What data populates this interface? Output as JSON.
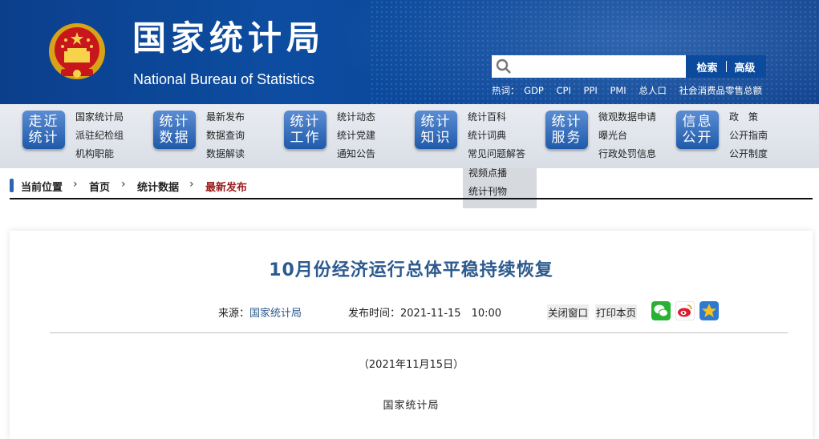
{
  "header": {
    "title": "国家统计局",
    "subtitle": "National Bureau of Statistics",
    "search": {
      "placeholder": "",
      "search_label": "检索",
      "advanced_label": "高级"
    },
    "hot_label": "热词：",
    "hot_words": [
      "GDP",
      "CPI",
      "PPI",
      "PMI",
      "总人口",
      "社会消费品零售总额"
    ]
  },
  "nav": [
    {
      "block": [
        "走近",
        "统计"
      ],
      "links": [
        "国家统计局",
        "派驻纪检组",
        "机构职能"
      ]
    },
    {
      "block": [
        "统计",
        "数据"
      ],
      "links": [
        "最新发布",
        "数据查询",
        "数据解读"
      ]
    },
    {
      "block": [
        "统计",
        "工作"
      ],
      "links": [
        "统计动态",
        "统计党建",
        "通知公告"
      ]
    },
    {
      "block": [
        "统计",
        "知识"
      ],
      "links": [
        "统计百科",
        "统计词典",
        "常见问题解答",
        "视频点播",
        "统计刊物"
      ]
    },
    {
      "block": [
        "统计",
        "服务"
      ],
      "links": [
        "微观数据申请",
        "曝光台",
        "行政处罚信息"
      ]
    },
    {
      "block": [
        "信息",
        "公开"
      ],
      "links": [
        "政　策",
        "公开指南",
        "公开制度"
      ]
    }
  ],
  "breadcrumb": {
    "label": "当前位置",
    "items": [
      "首页",
      "统计数据",
      "最新发布"
    ]
  },
  "article": {
    "title": "10月份经济运行总体平稳持续恢复",
    "source_label": "来源：",
    "source": "国家统计局",
    "time_label": "发布时间：",
    "time": "2021-11-15　10:00",
    "close_label": "关闭窗口",
    "print_label": "打印本页",
    "date_line": "（2021年11月15日）",
    "author_line": "国家统计局"
  },
  "icons": {
    "share": [
      "wechat-icon",
      "weibo-icon",
      "favorite-star-icon"
    ]
  },
  "colors": {
    "header_blue": "#0d4da1",
    "nav_block": "#2d64b3",
    "title_blue": "#2c5a8e",
    "current_crumb": "#9b1b1b"
  }
}
